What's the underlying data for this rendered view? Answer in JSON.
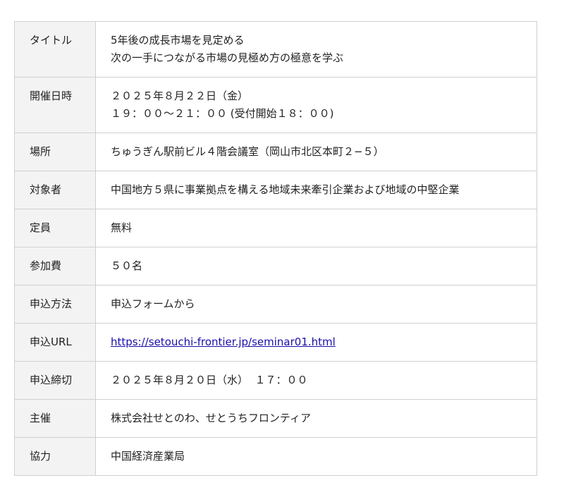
{
  "rows": [
    {
      "label": "タイトル",
      "lines": [
        "5年後の成長市場を見定める",
        "次の一手につながる市場の見極め方の極意を学ぶ"
      ]
    },
    {
      "label": "開催日時",
      "lines": [
        "２０２５年８月２２日（金）",
        "１９：００～２１：００ (受付開始１８：００)"
      ]
    },
    {
      "label": "場所",
      "lines": [
        "ちゅうぎん駅前ビル４階会議室（岡山市北区本町２−５）"
      ]
    },
    {
      "label": "対象者",
      "lines": [
        "中国地方５県に事業拠点を構える地域未来牽引企業および地域の中堅企業"
      ]
    },
    {
      "label": "定員",
      "lines": [
        "無料"
      ]
    },
    {
      "label": "参加費",
      "lines": [
        "５０名"
      ]
    },
    {
      "label": "申込方法",
      "lines": [
        "申込フォームから"
      ]
    },
    {
      "label": "申込URL",
      "link": "https://setouchi-frontier.jp/seminar01.html"
    },
    {
      "label": "申込締切",
      "lines": [
        "２０２５年８月２０日（水）  １７：００"
      ]
    },
    {
      "label": "主催",
      "lines": [
        "株式会社せとのわ、せとうちフロンティア"
      ]
    },
    {
      "label": "協力",
      "lines": [
        "中国経済産業局"
      ]
    }
  ]
}
